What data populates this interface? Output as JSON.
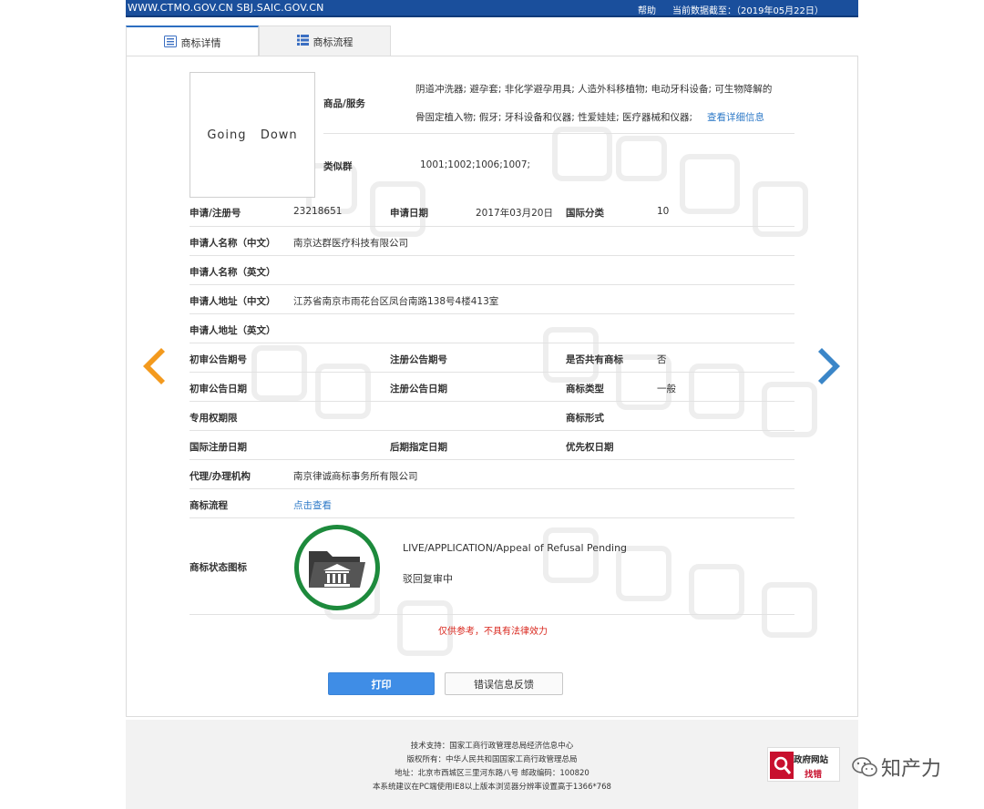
{
  "header": {
    "site": "WWW.CTMO.GOV.CN SBJ.SAIC.GOV.CN",
    "help": "帮助",
    "data_date": "当前数据截至：（2019年05月22日）"
  },
  "tabs": [
    {
      "label": "商标详情",
      "icon": "list-icon"
    },
    {
      "label": "商标流程",
      "icon": "grid-list-icon"
    }
  ],
  "trademark": {
    "image_text": "Going   Down",
    "goods_label": "商品/服务",
    "goods_line1": "阴道冲洗器; 避孕套; 非化学避孕用具; 人造外科移植物; 电动牙科设备; 可生物降解的",
    "goods_line2": "骨固定植入物; 假牙; 牙科设备和仪器; 性爱娃娃; 医疗器械和仪器;",
    "goods_more": "查看详细信息",
    "similar_label": "类似群",
    "similar_value": "1001;1002;1006;1007;"
  },
  "details": {
    "app_no_label": "申请/注册号",
    "app_no": "23218651",
    "app_date_label": "申请日期",
    "app_date": "2017年03月20日",
    "intl_class_label": "国际分类",
    "intl_class": "10",
    "applicant_cn_label": "申请人名称（中文）",
    "applicant_cn": "南京达群医疗科技有限公司",
    "applicant_en_label": "申请人名称（英文）",
    "address_cn_label": "申请人地址（中文）",
    "address_cn": "江苏省南京市雨花台区凤台南路138号4楼413室",
    "address_en_label": "申请人地址（英文）",
    "prelim_issue_label": "初审公告期号",
    "reg_issue_label": "注册公告期号",
    "shared_label": "是否共有商标",
    "shared": "否",
    "prelim_date_label": "初审公告日期",
    "reg_date_label": "注册公告日期",
    "tm_type_label": "商标类型",
    "tm_type": "一般",
    "exclusive_label": "专用权期限",
    "tm_form_label": "商标形式",
    "intl_reg_date_label": "国际注册日期",
    "later_designation_label": "后期指定日期",
    "priority_date_label": "优先权日期",
    "agent_label": "代理/办理机构",
    "agent": "南京律诚商标事务所有限公司",
    "process_label": "商标流程",
    "process_link": "点击查看",
    "status_label": "商标状态图标",
    "status_en": "LIVE/APPLICATION/Appeal of Refusal Pending",
    "status_cn": "驳回复审中"
  },
  "disclaimer": "仅供参考，不具有法律效力",
  "buttons": {
    "print": "打印",
    "feedback": "错误信息反馈"
  },
  "footer": {
    "line1": "技术支持：国家工商行政管理总局经济信息中心",
    "line2": "版权所有：中华人民共和国国家工商行政管理总局",
    "line3": "地址：北京市西城区三里河东路八号  邮政编码：100820",
    "line4": "本系统建议在PC端使用IE8以上版本浏览器分辨率设置高于1366*768"
  },
  "badge": {
    "line1": "政府网站",
    "line2": "找错"
  },
  "watermark_brand": "知产力",
  "colors": {
    "header_bg": "#1a4f9c",
    "print_button": "#3f8de6",
    "status_ring": "#1d8a3c",
    "disclaimer": "#d9261c",
    "link": "#2d79c7",
    "prev_arrow": "#f39a1e",
    "next_arrow": "#3b86c8"
  }
}
